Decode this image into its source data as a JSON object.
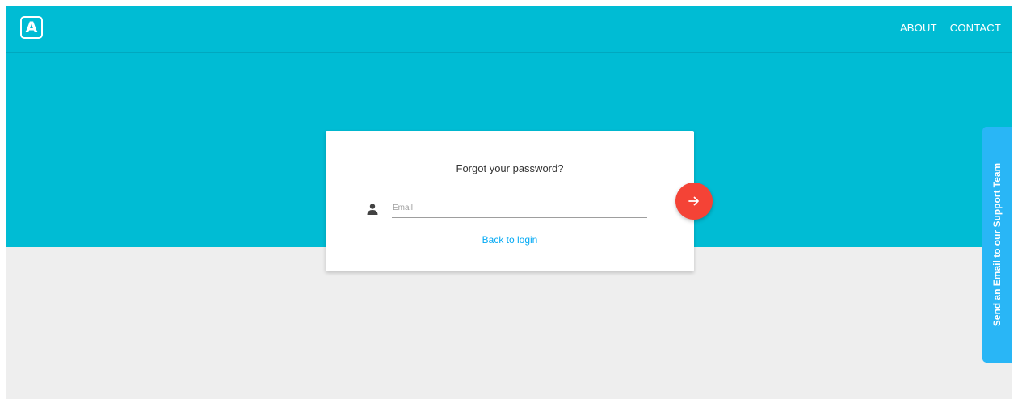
{
  "header": {
    "logo_text": "A",
    "nav": [
      {
        "label": "ABOUT"
      },
      {
        "label": "CONTACT"
      }
    ]
  },
  "card": {
    "title": "Forgot your password?",
    "email_placeholder": "Email",
    "email_value": "",
    "back_link": "Back to login",
    "user_icon": "person-icon",
    "submit_icon": "arrow-right-icon"
  },
  "support_tab": {
    "label": "Send an Email to our Support Team"
  },
  "colors": {
    "header_bg": "#00bcd4",
    "page_bg": "#eeeeee",
    "submit_button": "#f44336",
    "link": "#03a9f4",
    "support_tab": "#29b6f6"
  }
}
